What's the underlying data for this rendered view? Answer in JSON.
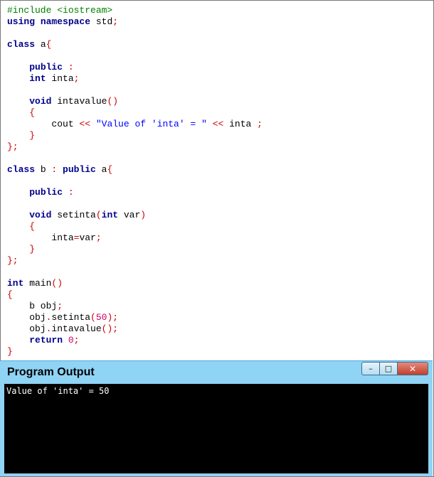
{
  "editor": {
    "lines": [
      [
        {
          "t": "pre",
          "v": "#include <iostream>"
        }
      ],
      [
        {
          "t": "kw",
          "v": "using"
        },
        {
          "t": "id",
          "v": " "
        },
        {
          "t": "kw",
          "v": "namespace"
        },
        {
          "t": "id",
          "v": " std"
        },
        {
          "t": "sym",
          "v": ";"
        }
      ],
      [],
      [
        {
          "t": "kw",
          "v": "class"
        },
        {
          "t": "id",
          "v": " a"
        },
        {
          "t": "sym",
          "v": "{"
        }
      ],
      [],
      [
        {
          "t": "id",
          "v": "    "
        },
        {
          "t": "kw",
          "v": "public"
        },
        {
          "t": "id",
          "v": " "
        },
        {
          "t": "sym",
          "v": ":"
        }
      ],
      [
        {
          "t": "id",
          "v": "    "
        },
        {
          "t": "kw",
          "v": "int"
        },
        {
          "t": "id",
          "v": " inta"
        },
        {
          "t": "sym",
          "v": ";"
        }
      ],
      [],
      [
        {
          "t": "id",
          "v": "    "
        },
        {
          "t": "kw",
          "v": "void"
        },
        {
          "t": "id",
          "v": " intavalue"
        },
        {
          "t": "sym",
          "v": "()"
        }
      ],
      [
        {
          "t": "id",
          "v": "    "
        },
        {
          "t": "sym",
          "v": "{"
        }
      ],
      [
        {
          "t": "id",
          "v": "        cout "
        },
        {
          "t": "sym",
          "v": "<<"
        },
        {
          "t": "id",
          "v": " "
        },
        {
          "t": "str",
          "v": "\"Value of 'inta' = \""
        },
        {
          "t": "id",
          "v": " "
        },
        {
          "t": "sym",
          "v": "<<"
        },
        {
          "t": "id",
          "v": " inta "
        },
        {
          "t": "sym",
          "v": ";"
        }
      ],
      [
        {
          "t": "id",
          "v": "    "
        },
        {
          "t": "sym",
          "v": "}"
        }
      ],
      [
        {
          "t": "sym",
          "v": "};"
        }
      ],
      [],
      [
        {
          "t": "kw",
          "v": "class"
        },
        {
          "t": "id",
          "v": " b "
        },
        {
          "t": "sym",
          "v": ":"
        },
        {
          "t": "id",
          "v": " "
        },
        {
          "t": "kw",
          "v": "public"
        },
        {
          "t": "id",
          "v": " a"
        },
        {
          "t": "sym",
          "v": "{"
        }
      ],
      [],
      [
        {
          "t": "id",
          "v": "    "
        },
        {
          "t": "kw",
          "v": "public"
        },
        {
          "t": "id",
          "v": " "
        },
        {
          "t": "sym",
          "v": ":"
        }
      ],
      [],
      [
        {
          "t": "id",
          "v": "    "
        },
        {
          "t": "kw",
          "v": "void"
        },
        {
          "t": "id",
          "v": " setinta"
        },
        {
          "t": "sym",
          "v": "("
        },
        {
          "t": "kw",
          "v": "int"
        },
        {
          "t": "id",
          "v": " var"
        },
        {
          "t": "sym",
          "v": ")"
        }
      ],
      [
        {
          "t": "id",
          "v": "    "
        },
        {
          "t": "sym",
          "v": "{"
        }
      ],
      [
        {
          "t": "id",
          "v": "        inta"
        },
        {
          "t": "sym",
          "v": "="
        },
        {
          "t": "id",
          "v": "var"
        },
        {
          "t": "sym",
          "v": ";"
        }
      ],
      [
        {
          "t": "id",
          "v": "    "
        },
        {
          "t": "sym",
          "v": "}"
        }
      ],
      [
        {
          "t": "sym",
          "v": "};"
        }
      ],
      [],
      [
        {
          "t": "kw",
          "v": "int"
        },
        {
          "t": "id",
          "v": " main"
        },
        {
          "t": "sym",
          "v": "()"
        }
      ],
      [
        {
          "t": "sym",
          "v": "{"
        }
      ],
      [
        {
          "t": "id",
          "v": "    b obj"
        },
        {
          "t": "sym",
          "v": ";"
        }
      ],
      [
        {
          "t": "id",
          "v": "    obj"
        },
        {
          "t": "sym",
          "v": "."
        },
        {
          "t": "id",
          "v": "setinta"
        },
        {
          "t": "sym",
          "v": "("
        },
        {
          "t": "num",
          "v": "50"
        },
        {
          "t": "sym",
          "v": ");"
        }
      ],
      [
        {
          "t": "id",
          "v": "    obj"
        },
        {
          "t": "sym",
          "v": "."
        },
        {
          "t": "id",
          "v": "intavalue"
        },
        {
          "t": "sym",
          "v": "();"
        }
      ],
      [
        {
          "t": "id",
          "v": "    "
        },
        {
          "t": "kw",
          "v": "return"
        },
        {
          "t": "id",
          "v": " "
        },
        {
          "t": "num",
          "v": "0"
        },
        {
          "t": "sym",
          "v": ";"
        }
      ],
      [
        {
          "t": "sym",
          "v": "}"
        }
      ]
    ]
  },
  "output_window": {
    "title": "Program Output",
    "minimize_glyph": "–",
    "maximize_glyph": "□",
    "close_glyph": "✕",
    "console_text": "Value of 'inta' = 50"
  },
  "colors": {
    "preprocessor": "#008000",
    "keyword": "#00008b",
    "symbol": "#cc0000",
    "string": "#0000ff",
    "number": "#cc0066",
    "window_title_bar": "#8fd3f5",
    "console_background": "#000000"
  }
}
